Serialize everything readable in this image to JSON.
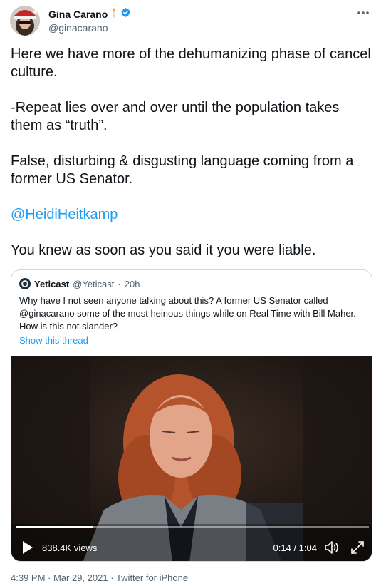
{
  "author": {
    "display_name": "Gina Carano",
    "handle": "@ginacarano",
    "name_emoji_icon": "candle-icon",
    "verified_icon": "verified-badge-icon"
  },
  "more_icon": "more-dots-icon",
  "tweet": {
    "paragraphs": [
      "Here we have more of the dehumanizing phase of cancel culture.",
      "-Repeat lies over and over until the population takes them as “truth”.",
      "False, disturbing & disgusting language coming from a former US Senator."
    ],
    "mention": "@HeidiHeitkamp",
    "closing": "You knew as soon as you said it you were liable."
  },
  "quote": {
    "display_name": "Yeticast",
    "handle": "@Yeticast",
    "separator": "·",
    "age": "20h",
    "text": "Why have I not seen anyone talking about this? A former US Senator called @ginacarano some of the most heinous things while on Real Time with Bill Maher. How is this not slander?",
    "show_thread": "Show this thread",
    "video": {
      "views": "838.4K views",
      "time": "0:14 / 1:04",
      "progress": 0.22
    }
  },
  "footer": {
    "timestamp": "4:39 PM · Mar 29, 2021",
    "source": "Twitter for iPhone",
    "separator": "·"
  },
  "colors": {
    "link": "#1d9bf0",
    "text": "#0f1419",
    "muted": "#536471",
    "border": "#cfd9de"
  }
}
